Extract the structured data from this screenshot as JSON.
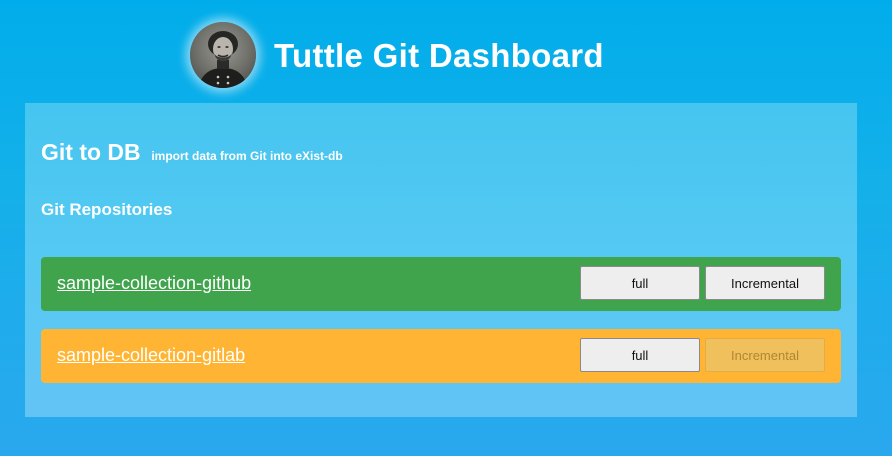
{
  "header": {
    "title": "Tuttle Git Dashboard"
  },
  "section": {
    "title": "Git to DB",
    "subtitle": "import data from Git into eXist-db",
    "repositories_heading": "Git Repositories"
  },
  "repositories": [
    {
      "name": "sample-collection-github",
      "status_color": "#3fa44b",
      "full_label": "full",
      "incremental_label": "Incremental",
      "incremental_enabled": true
    },
    {
      "name": "sample-collection-gitlab",
      "status_color": "#ffb533",
      "full_label": "full",
      "incremental_label": "Incremental",
      "incremental_enabled": false
    }
  ],
  "colors": {
    "background": "#00adea",
    "panel": "#4fc7f2",
    "text": "#ffffff"
  }
}
